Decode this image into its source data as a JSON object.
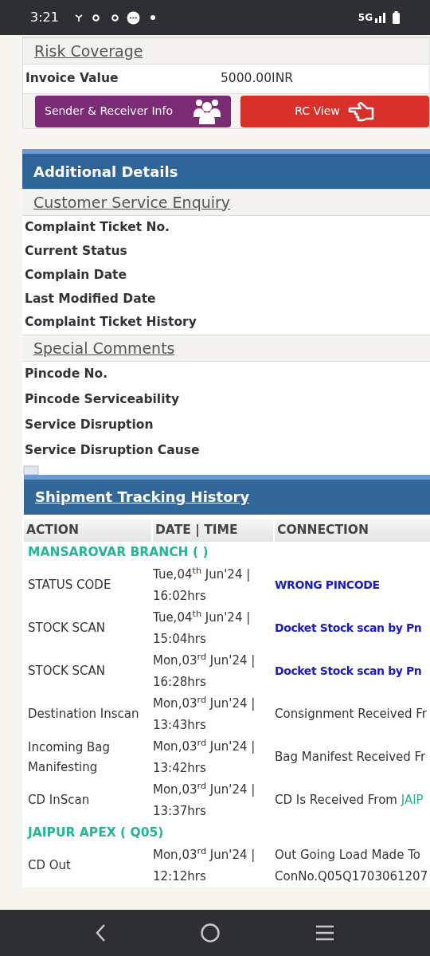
{
  "status_bar": {
    "time": "3:21",
    "network": "5G"
  },
  "risk_coverage": {
    "title": "Risk Coverage",
    "rows": [
      {
        "label": "Invoice Value",
        "value": "5000.00INR"
      }
    ]
  },
  "buttons": [
    {
      "label": "Sender & Receiver Info",
      "kind": "people"
    },
    {
      "label": "RC View",
      "kind": "pointer"
    }
  ],
  "additional_details": {
    "title": "Additional Details",
    "sections": [
      {
        "title": "Customer Service Enquiry",
        "fields": [
          "Complaint Ticket No.",
          "Current Status",
          "Complain Date",
          "Last Modified Date",
          "Complaint Ticket History"
        ]
      },
      {
        "title": "Special Comments",
        "fields": [
          "Pincode No.",
          "Pincode Serviceability",
          "Service Disruption",
          "Service Disruption Cause"
        ]
      }
    ]
  },
  "tracking": {
    "title": "Shipment Tracking History",
    "columns": [
      "ACTION",
      "DATE | TIME",
      "CONNECTION"
    ],
    "rows": [
      {
        "kind": "hub",
        "name": "MANSAROVAR BRANCH ( )"
      },
      {
        "kind": "event",
        "action": "STATUS CODE",
        "date": "Tue,04$^{th}$ Jun'24 |",
        "time": "16:02hrs",
        "connection": [
          {
            "kind": "link",
            "text": "WRONG PINCODE"
          }
        ]
      },
      {
        "kind": "event",
        "action": "STOCK SCAN",
        "date": "Tue,04$^{th}$ Jun'24 |",
        "time": "15:04hrs",
        "connection": [
          {
            "kind": "link",
            "text": "Docket Stock scan by Pn"
          }
        ]
      },
      {
        "kind": "event",
        "action": "STOCK SCAN",
        "date": "Mon,03$^{rd}$ Jun'24 |",
        "time": "16:28hrs",
        "connection": [
          {
            "kind": "link",
            "text": "Docket Stock scan by Pn"
          }
        ]
      },
      {
        "kind": "event",
        "action": "Destination Inscan",
        "date": "Mon,03$^{rd}$ Jun'24 |",
        "time": "13:43hrs",
        "connection": [
          {
            "kind": "plain",
            "text": "Consignment Received Fr"
          }
        ]
      },
      {
        "kind": "event",
        "action": "Incoming Bag Manifesting",
        "date": "Mon,03$^{rd}$ Jun'24 |",
        "time": "13:42hrs",
        "connection": [
          {
            "kind": "plain",
            "text": "Bag Manifest Received Fr"
          }
        ]
      },
      {
        "kind": "event",
        "action": "CD InScan",
        "date": "Mon,03$^{rd}$ Jun'24 |",
        "time": "13:37hrs",
        "connection": [
          {
            "kind": "plain",
            "text": "CD Is Received From "
          },
          {
            "kind": "hub",
            "text": "JAIP"
          }
        ]
      },
      {
        "kind": "hub",
        "name": "JAIPUR APEX ( Q05)"
      },
      {
        "kind": "event",
        "action": "CD Out",
        "date": "Mon,03$^{rd}$ Jun'24 |",
        "time": "12:12hrs",
        "connection": [
          {
            "kind": "plain",
            "text": "Out Going Load Made To"
          },
          {
            "kind": "break"
          },
          {
            "kind": "plain",
            "text": "ConNo.Q05Q1703061207"
          }
        ]
      }
    ]
  }
}
